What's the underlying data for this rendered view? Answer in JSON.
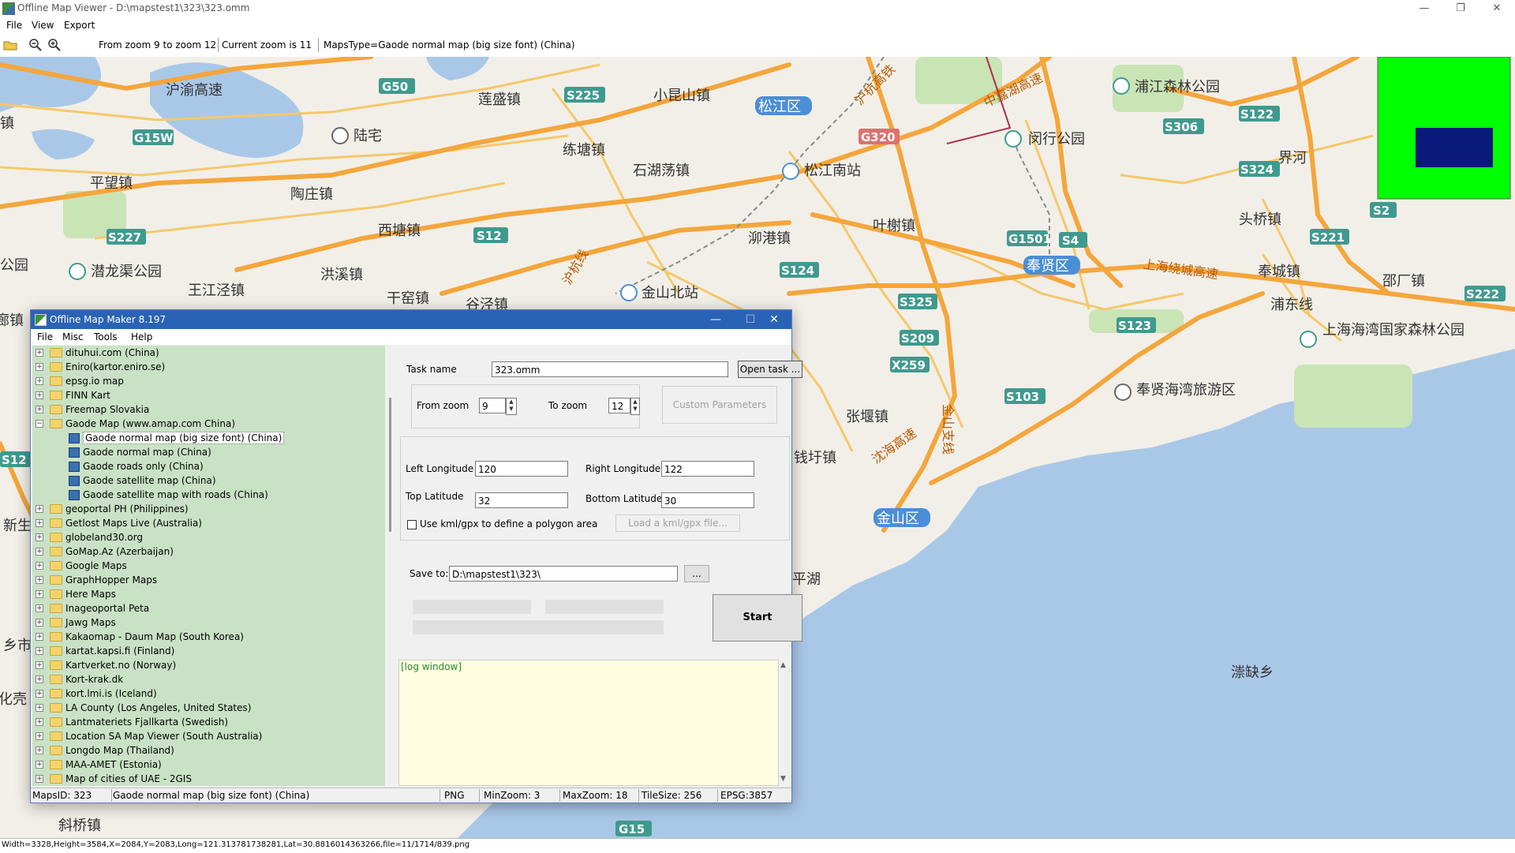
{
  "viewer": {
    "title": "Offline Map Viewer - D:\\mapstest1\\323\\323.omm",
    "window_controls": [
      "—",
      "❐",
      "✕"
    ],
    "menu": [
      "File",
      "View",
      "Export"
    ],
    "toolbar": {
      "zoom_range": "From zoom 9 to zoom 12",
      "current_zoom": "Current zoom is 11",
      "maps_type": "MapsType=Gaode normal map (big size font) (China)"
    },
    "status": "Width=3328,Height=3584,X=2084,Y=2083,Long=121.313781738281,Lat=30.8816014363266,file=11/1714/839.png"
  },
  "map": {
    "colors": {
      "land": "#f2efe8",
      "water": "#a9c8e8",
      "road_major": "#f4a63c",
      "road_minor": "#f6c86a",
      "green": "#c9e4b5",
      "shield": "#3f9a8e",
      "district": "#4a8fd6",
      "overview_bg": "#00ff00",
      "overview_view": "#0a1a7a"
    },
    "places": [
      "沪渝高速",
      "莲盛镇",
      "小昆山镇",
      "陆宅",
      "练塘镇",
      "石湖荡镇",
      "松江南站",
      "平望镇",
      "陶庄镇",
      "西塘镇",
      "泖港镇",
      "叶榭镇",
      "潜龙渠公园",
      "洪溪镇",
      "王江泾镇",
      "干窑镇",
      "金山北站",
      "浦江森林公园",
      "闵行公园",
      "中嘉湖高速",
      "沪杭高铁",
      "头桥镇",
      "界河",
      "上海绕城高速",
      "奉城镇",
      "邵厂镇",
      "浦东线",
      "上海海湾国家森林公园",
      "奉贤海湾旅游区",
      "张堰镇",
      "沈海高速",
      "钱圩镇",
      "金山支线",
      "漴缺乡",
      "新生",
      "廊镇",
      "化壳",
      "斜桥镇",
      "平湖",
      "乡市",
      "镇",
      "公园",
      "谷泾镇",
      "沪杭线"
    ],
    "districts": [
      "松江区",
      "奉贤区",
      "金山区"
    ],
    "shields": [
      "G50",
      "S225",
      "G15W",
      "G320",
      "S12",
      "S4",
      "S227",
      "S124",
      "S325",
      "S209",
      "X259",
      "G1501",
      "S103",
      "S123",
      "S306",
      "S122",
      "S324",
      "S2",
      "S221",
      "S222",
      "G15",
      "S12"
    ]
  },
  "maker": {
    "title": "Offline Map Maker 8.197",
    "window_controls": [
      "—",
      "☐",
      "✕"
    ],
    "menu": [
      "File",
      "Misc",
      "Tools",
      "Help"
    ],
    "tree": [
      {
        "label": "dituhui.com (China)",
        "type": "folder"
      },
      {
        "label": "Eniro(kartor.eniro.se)",
        "type": "folder"
      },
      {
        "label": "epsg.io map",
        "type": "folder"
      },
      {
        "label": "FINN Kart",
        "type": "folder"
      },
      {
        "label": "Freemap Slovakia",
        "type": "folder"
      },
      {
        "label": "Gaode Map (www.amap.com China)",
        "type": "open"
      },
      {
        "label": "Gaode normal map (big size font) (China)",
        "type": "map",
        "selected": true
      },
      {
        "label": "Gaode normal map (China)",
        "type": "map"
      },
      {
        "label": "Gaode roads only (China)",
        "type": "map"
      },
      {
        "label": "Gaode satellite map (China)",
        "type": "map"
      },
      {
        "label": "Gaode satellite map with roads (China)",
        "type": "map"
      },
      {
        "label": "geoportal PH (Philippines)",
        "type": "folder"
      },
      {
        "label": "Getlost Maps Live (Australia)",
        "type": "folder"
      },
      {
        "label": "globeland30.org",
        "type": "folder"
      },
      {
        "label": "GoMap.Az (Azerbaijan)",
        "type": "folder"
      },
      {
        "label": "Google Maps",
        "type": "folder"
      },
      {
        "label": "GraphHopper Maps",
        "type": "folder"
      },
      {
        "label": "Here Maps",
        "type": "folder"
      },
      {
        "label": "Inageoportal Peta",
        "type": "folder"
      },
      {
        "label": "Jawg Maps",
        "type": "folder"
      },
      {
        "label": "Kakaomap - Daum Map (South Korea)",
        "type": "folder"
      },
      {
        "label": "kartat.kapsi.fi (Finland)",
        "type": "folder"
      },
      {
        "label": "Kartverket.no (Norway)",
        "type": "folder"
      },
      {
        "label": "Kort-krak.dk",
        "type": "folder"
      },
      {
        "label": "kort.lmi.is (Iceland)",
        "type": "folder"
      },
      {
        "label": "LA County (Los Angeles, United States)",
        "type": "folder"
      },
      {
        "label": "Lantmateriets Fjallkarta (Swedish)",
        "type": "folder"
      },
      {
        "label": "Location SA Map Viewer (South Australia)",
        "type": "folder"
      },
      {
        "label": "Longdo Map (Thailand)",
        "type": "folder"
      },
      {
        "label": "MAA-AMET (Estonia)",
        "type": "folder"
      },
      {
        "label": "Map of cities of UAE - 2GIS",
        "type": "folder"
      }
    ],
    "form": {
      "task_name_label": "Task name",
      "task_name_value": "323.omm",
      "open_task": "Open task ...",
      "from_zoom_label": "From zoom",
      "from_zoom_value": "9",
      "to_zoom_label": "To zoom",
      "to_zoom_value": "12",
      "custom_params": "Custom Parameters",
      "left_lon_label": "Left Longitude",
      "left_lon_value": "120",
      "right_lon_label": "Right Longitude",
      "right_lon_value": "122",
      "top_lat_label": "Top Latitude",
      "top_lat_value": "32",
      "bottom_lat_label": "Bottom Latitude",
      "bottom_lat_value": "30",
      "kml_checkbox": "Use kml/gpx to define a polygon area",
      "load_kml": "Load a kml/gpx file...",
      "save_to_label": "Save to:",
      "save_to_value": "D:\\mapstest1\\323\\",
      "browse": "...",
      "start": "Start"
    },
    "log": "[log window]",
    "status": {
      "maps_id": "MapsID: 323",
      "map_name": "Gaode normal map (big size font) (China)",
      "format": "PNG",
      "min_zoom": "MinZoom: 3",
      "max_zoom": "MaxZoom: 18",
      "tile_size": "TileSize: 256",
      "epsg": "EPSG:3857"
    }
  }
}
